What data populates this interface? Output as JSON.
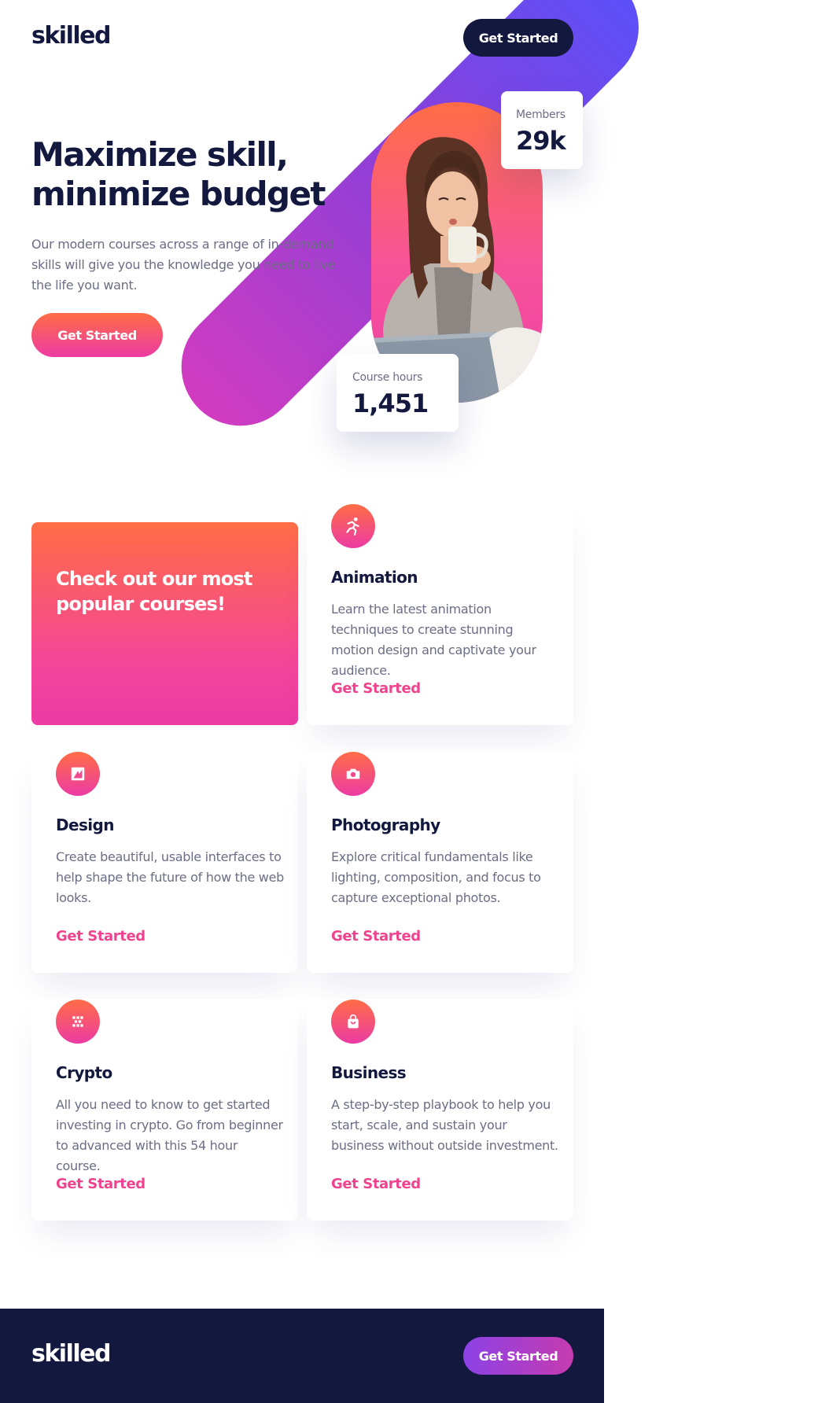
{
  "header": {
    "logo": "skilled",
    "cta_label": "Get Started"
  },
  "hero": {
    "title": "Maximize skill, minimize budget",
    "text": "Our modern courses across a range of in-demand skills will give you the knowledge you need to live the life you want.",
    "cta_label": "Get Started",
    "stats": {
      "members_label": "Members",
      "members_value": "29k",
      "hours_label": "Course hours",
      "hours_value": "1,451"
    }
  },
  "courses": {
    "promo_title": "Check out our most popular courses!",
    "items": [
      {
        "title": "Animation",
        "text": "Learn the latest animation techniques to create stunning motion design and captivate your audience.",
        "link": "Get Started",
        "icon": "running-icon"
      },
      {
        "title": "Design",
        "text": "Create beautiful, usable interfaces to help shape the future of how the web looks.",
        "link": "Get Started",
        "icon": "design-icon"
      },
      {
        "title": "Photography",
        "text": "Explore critical fundamentals like lighting, composition, and focus to capture exceptional photos.",
        "link": "Get Started",
        "icon": "camera-icon"
      },
      {
        "title": "Crypto",
        "text": "All you need to know to get started investing in crypto. Go from beginner to advanced with this 54 hour course.",
        "link": "Get Started",
        "icon": "crypto-icon"
      },
      {
        "title": "Business",
        "text": "A step-by-step playbook to help you start, scale, and sustain your business without outside investment.",
        "link": "Get Started",
        "icon": "shopping-bag-icon"
      }
    ]
  },
  "footer": {
    "logo": "skilled",
    "cta_label": "Get Started"
  },
  "colors": {
    "navy": "#13183f",
    "gradient_start": "#ff6d45",
    "gradient_end": "#ec3ba4",
    "link": "#f0438f",
    "purple": "#5b50f8"
  }
}
